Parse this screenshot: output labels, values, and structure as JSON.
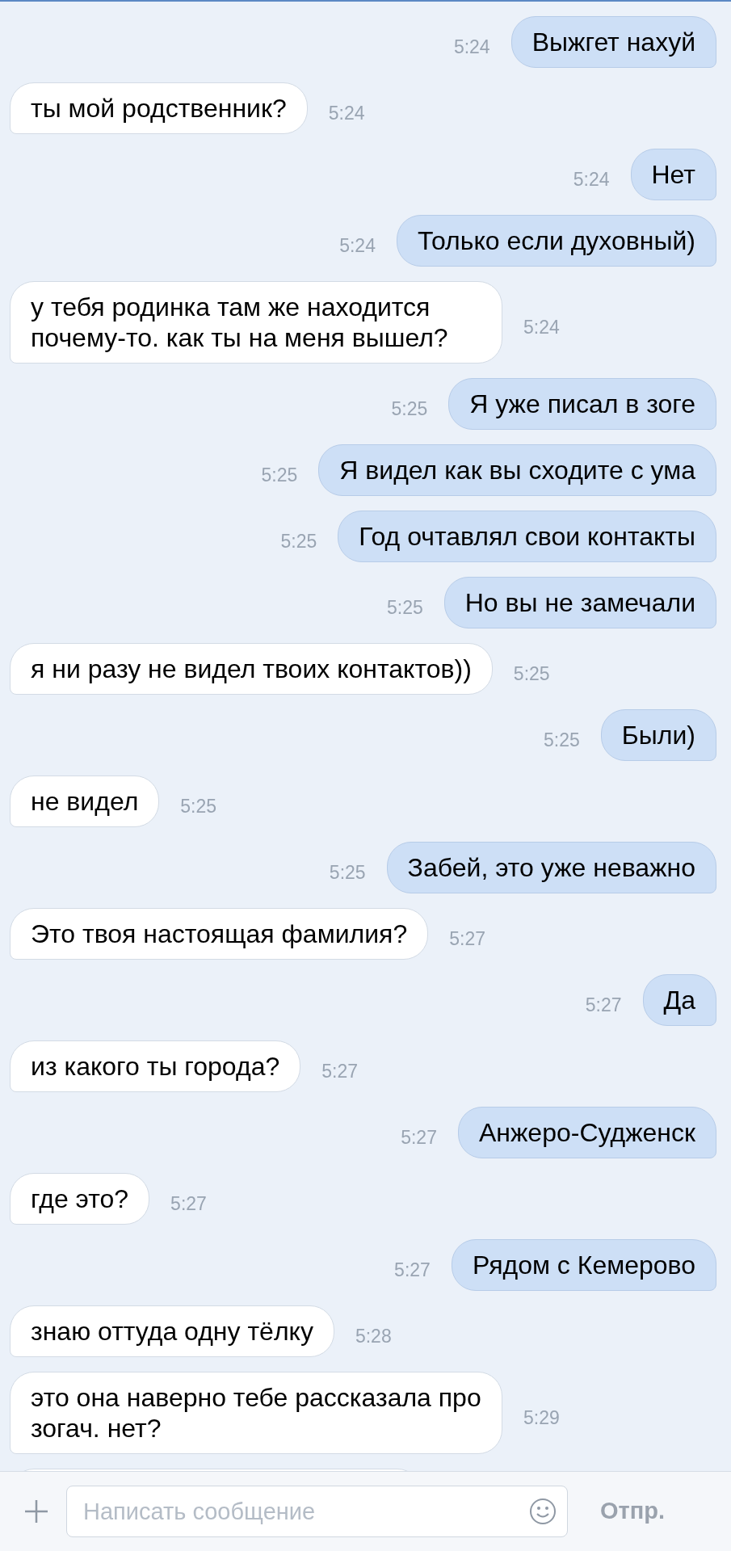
{
  "messages": [
    {
      "kind": "outgoing",
      "text": "Выжгет нахуй",
      "time": "5:24"
    },
    {
      "kind": "incoming",
      "text": "ты мой родственник?",
      "time": "5:24"
    },
    {
      "kind": "outgoing",
      "text": "Нет",
      "time": "5:24"
    },
    {
      "kind": "outgoing",
      "text": "Только если духовный)",
      "time": "5:24"
    },
    {
      "kind": "incoming",
      "text": "у тебя родинка там же находится почему-то. как ты на меня вышел?",
      "time": "5:24"
    },
    {
      "kind": "outgoing",
      "text": "Я уже писал в зоге",
      "time": "5:25"
    },
    {
      "kind": "outgoing",
      "text": "Я видел как вы сходите с ума",
      "time": "5:25"
    },
    {
      "kind": "outgoing",
      "text": "Год очтавлял свои контакты",
      "time": "5:25"
    },
    {
      "kind": "outgoing",
      "text": "Но вы не замечали",
      "time": "5:25"
    },
    {
      "kind": "incoming",
      "text": "я ни разу не видел твоих контактов))",
      "time": "5:25"
    },
    {
      "kind": "outgoing",
      "text": "Были)",
      "time": "5:25"
    },
    {
      "kind": "incoming",
      "text": "не видел",
      "time": "5:25"
    },
    {
      "kind": "outgoing",
      "text": "Забей, это уже неважно",
      "time": "5:25"
    },
    {
      "kind": "incoming",
      "text": "Это твоя настоящая фамилия?",
      "time": "5:27"
    },
    {
      "kind": "outgoing",
      "text": "Да",
      "time": "5:27"
    },
    {
      "kind": "incoming",
      "text": "из какого ты города?",
      "time": "5:27"
    },
    {
      "kind": "outgoing",
      "text": "Анжеро-Судженск",
      "time": "5:27"
    },
    {
      "kind": "incoming",
      "text": "где это?",
      "time": "5:27"
    },
    {
      "kind": "outgoing",
      "text": "Рядом с Кемерово",
      "time": "5:27"
    },
    {
      "kind": "incoming",
      "text": "знаю оттуда одну тёлку",
      "time": "5:28"
    },
    {
      "kind": "incoming",
      "text": "это она наверно тебе рассказала про зогач. нет?",
      "time": "5:29"
    },
    {
      "kind": "hidden"
    }
  ],
  "composer": {
    "placeholder": "Написать сообщение",
    "send": "Отпр."
  }
}
